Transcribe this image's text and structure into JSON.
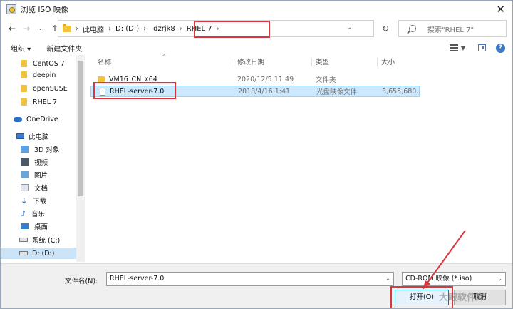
{
  "window": {
    "title": "浏览 ISO 映像",
    "close_glyph": "✕"
  },
  "nav": {
    "back": "←",
    "forward": "→",
    "recent": "⌄",
    "up": "↑",
    "refresh": "↻"
  },
  "breadcrumb": [
    "此电脑",
    "D: (D:)",
    "dzrjk8",
    "RHEL 7"
  ],
  "search": {
    "placeholder": "搜索\"RHEL 7\""
  },
  "toolbar": {
    "organize": "组织 ▾",
    "new_folder": "新建文件夹",
    "help": "?"
  },
  "sidebar": {
    "items": [
      {
        "label": "CentOS 7",
        "icon": "folder-icon"
      },
      {
        "label": "deepin",
        "icon": "folder-icon"
      },
      {
        "label": "openSUSE",
        "icon": "folder-icon"
      },
      {
        "label": "RHEL 7",
        "icon": "folder-icon"
      },
      {
        "label": "OneDrive",
        "icon": "onedrive-icon"
      },
      {
        "label": "此电脑",
        "icon": "this-pc-icon"
      },
      {
        "label": "3D 对象",
        "icon": "3d-objects-icon"
      },
      {
        "label": "视频",
        "icon": "videos-icon"
      },
      {
        "label": "图片",
        "icon": "pictures-icon"
      },
      {
        "label": "文档",
        "icon": "documents-icon"
      },
      {
        "label": "下载",
        "icon": "downloads-icon"
      },
      {
        "label": "音乐",
        "icon": "music-icon"
      },
      {
        "label": "桌面",
        "icon": "desktop-icon"
      },
      {
        "label": "系统 (C:)",
        "icon": "drive-c-icon"
      },
      {
        "label": "D: (D:)",
        "icon": "drive-d-icon"
      }
    ]
  },
  "columns": {
    "name": "名称",
    "modified": "修改日期",
    "type": "类型",
    "size": "大小"
  },
  "files": [
    {
      "name": "VM16_CN_x64",
      "modified": "2020/12/5 11:49",
      "type": "文件夹",
      "size": ""
    },
    {
      "name": "RHEL-server-7.0",
      "modified": "2018/4/16 1:41",
      "type": "光盘映像文件",
      "size": "3,655,680..."
    }
  ],
  "footer": {
    "filename_label": "文件名(N):",
    "filename_value": "RHEL-server-7.0",
    "filetype_value": "CD-ROM 映像 (*.iso)",
    "open_label": "打开(O)",
    "cancel_label": "取消",
    "watermark": "大眼软件库"
  },
  "colors": {
    "highlight_red": "#d9363e",
    "selection_blue": "#cce8ff",
    "accent": "#0078d7"
  }
}
